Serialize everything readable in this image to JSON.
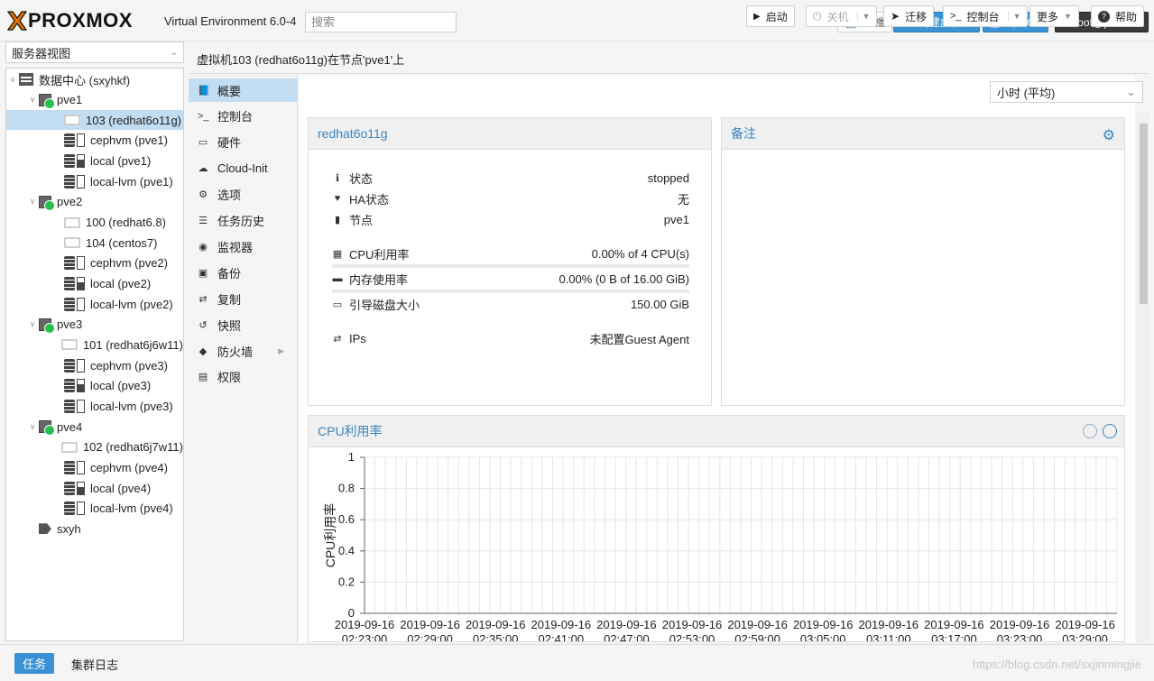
{
  "topbar": {
    "logo_text": "PROXMOX",
    "version": "Virtual Environment 6.0-4",
    "search_placeholder": "搜索",
    "docs_label": "文档",
    "create_vm_label": "创建虚拟机",
    "create_ct_label": "创建CT",
    "user_label": "root@pam"
  },
  "sidebar": {
    "view_label": "服务器视图",
    "tree": [
      {
        "label": "数据中心 (sxyhkf)",
        "type": "datacenter",
        "indent": 0
      },
      {
        "label": "pve1",
        "type": "node",
        "indent": 1
      },
      {
        "label": "103 (redhat6o11g)",
        "type": "vm",
        "indent": 2,
        "selected": true
      },
      {
        "label": "cephvm (pve1)",
        "type": "storage",
        "indent": 2
      },
      {
        "label": "local (pve1)",
        "type": "storage-used",
        "indent": 2
      },
      {
        "label": "local-lvm (pve1)",
        "type": "storage",
        "indent": 2
      },
      {
        "label": "pve2",
        "type": "node",
        "indent": 1
      },
      {
        "label": "100 (redhat6.8)",
        "type": "vm",
        "indent": 2
      },
      {
        "label": "104 (centos7)",
        "type": "vm",
        "indent": 2
      },
      {
        "label": "cephvm (pve2)",
        "type": "storage",
        "indent": 2
      },
      {
        "label": "local (pve2)",
        "type": "storage-used",
        "indent": 2
      },
      {
        "label": "local-lvm (pve2)",
        "type": "storage",
        "indent": 2
      },
      {
        "label": "pve3",
        "type": "node",
        "indent": 1
      },
      {
        "label": "101 (redhat6j6w11)",
        "type": "vm",
        "indent": 2
      },
      {
        "label": "cephvm (pve3)",
        "type": "storage",
        "indent": 2
      },
      {
        "label": "local (pve3)",
        "type": "storage-used",
        "indent": 2
      },
      {
        "label": "local-lvm (pve3)",
        "type": "storage",
        "indent": 2
      },
      {
        "label": "pve4",
        "type": "node",
        "indent": 1
      },
      {
        "label": "102 (redhat6j7w11)",
        "type": "vm",
        "indent": 2
      },
      {
        "label": "cephvm (pve4)",
        "type": "storage",
        "indent": 2
      },
      {
        "label": "local (pve4)",
        "type": "storage-used",
        "indent": 2
      },
      {
        "label": "local-lvm (pve4)",
        "type": "storage",
        "indent": 2
      },
      {
        "label": "sxyh",
        "type": "tag",
        "indent": 1
      }
    ]
  },
  "header": {
    "title": "虚拟机103 (redhat6o11g)在节点'pve1'上",
    "start_label": "启动",
    "shutdown_label": "关机",
    "migrate_label": "迁移",
    "console_label": "控制台",
    "more_label": "更多",
    "help_label": "帮助"
  },
  "nav": [
    {
      "label": "概要",
      "icon": "book-icon",
      "selected": true
    },
    {
      "label": "控制台",
      "icon": "terminal-icon"
    },
    {
      "label": "硬件",
      "icon": "monitor-icon"
    },
    {
      "label": "Cloud-Init",
      "icon": "cloud-icon"
    },
    {
      "label": "选项",
      "icon": "gear-icon"
    },
    {
      "label": "任务历史",
      "icon": "list-icon"
    },
    {
      "label": "监视器",
      "icon": "eye-icon"
    },
    {
      "label": "备份",
      "icon": "floppy-icon"
    },
    {
      "label": "复制",
      "icon": "retweet-icon"
    },
    {
      "label": "快照",
      "icon": "history-icon"
    },
    {
      "label": "防火墙",
      "icon": "shield-icon",
      "has_children": true
    },
    {
      "label": "权限",
      "icon": "unlock-icon"
    }
  ],
  "timeframe": {
    "value": "小时 (平均)"
  },
  "status_panel": {
    "title": "redhat6o11g",
    "rows": [
      {
        "label": "状态",
        "value": "stopped",
        "icon": "info-icon"
      },
      {
        "label": "HA状态",
        "value": "无",
        "icon": "heartbeat-icon"
      },
      {
        "label": "节点",
        "value": "pve1",
        "icon": "building-icon"
      },
      {
        "label": "CPU利用率",
        "value": "0.00% of 4 CPU(s)",
        "icon": "cpu-icon",
        "progress": 0
      },
      {
        "label": "内存使用率",
        "value": "0.00% (0 B of 16.00 GiB)",
        "icon": "memory-icon",
        "progress": 0
      },
      {
        "label": "引导磁盘大小",
        "value": "150.00 GiB",
        "icon": "hdd-icon"
      },
      {
        "label": "IPs",
        "value": "未配置Guest Agent",
        "icon": "exchange-icon"
      }
    ]
  },
  "notes_panel": {
    "title": "备注"
  },
  "chart_data": {
    "type": "line",
    "title": "CPU利用率",
    "ylabel": "CPU利用率",
    "xlabel": "",
    "ylim": [
      0,
      1
    ],
    "yticks": [
      "1",
      "0.8",
      "0.6",
      "0.4",
      "0.2",
      "0"
    ],
    "xticks": [
      {
        "date": "2019-09-16",
        "time": "02:23:00"
      },
      {
        "date": "2019-09-16",
        "time": "02:29:00"
      },
      {
        "date": "2019-09-16",
        "time": "02:35:00"
      },
      {
        "date": "2019-09-16",
        "time": "02:41:00"
      },
      {
        "date": "2019-09-16",
        "time": "02:47:00"
      },
      {
        "date": "2019-09-16",
        "time": "02:53:00"
      },
      {
        "date": "2019-09-16",
        "time": "02:59:00"
      },
      {
        "date": "2019-09-16",
        "time": "03:05:00"
      },
      {
        "date": "2019-09-16",
        "time": "03:11:00"
      },
      {
        "date": "2019-09-16",
        "time": "03:17:00"
      },
      {
        "date": "2019-09-16",
        "time": "03:23:00"
      },
      {
        "date": "2019-09-16",
        "time": "03:29:00"
      }
    ],
    "series": [],
    "grid": true
  },
  "footer": {
    "tasks_label": "任务",
    "cluster_log_label": "集群日志",
    "watermark": "https://blog.csdn.net/sxjinmingjie"
  }
}
